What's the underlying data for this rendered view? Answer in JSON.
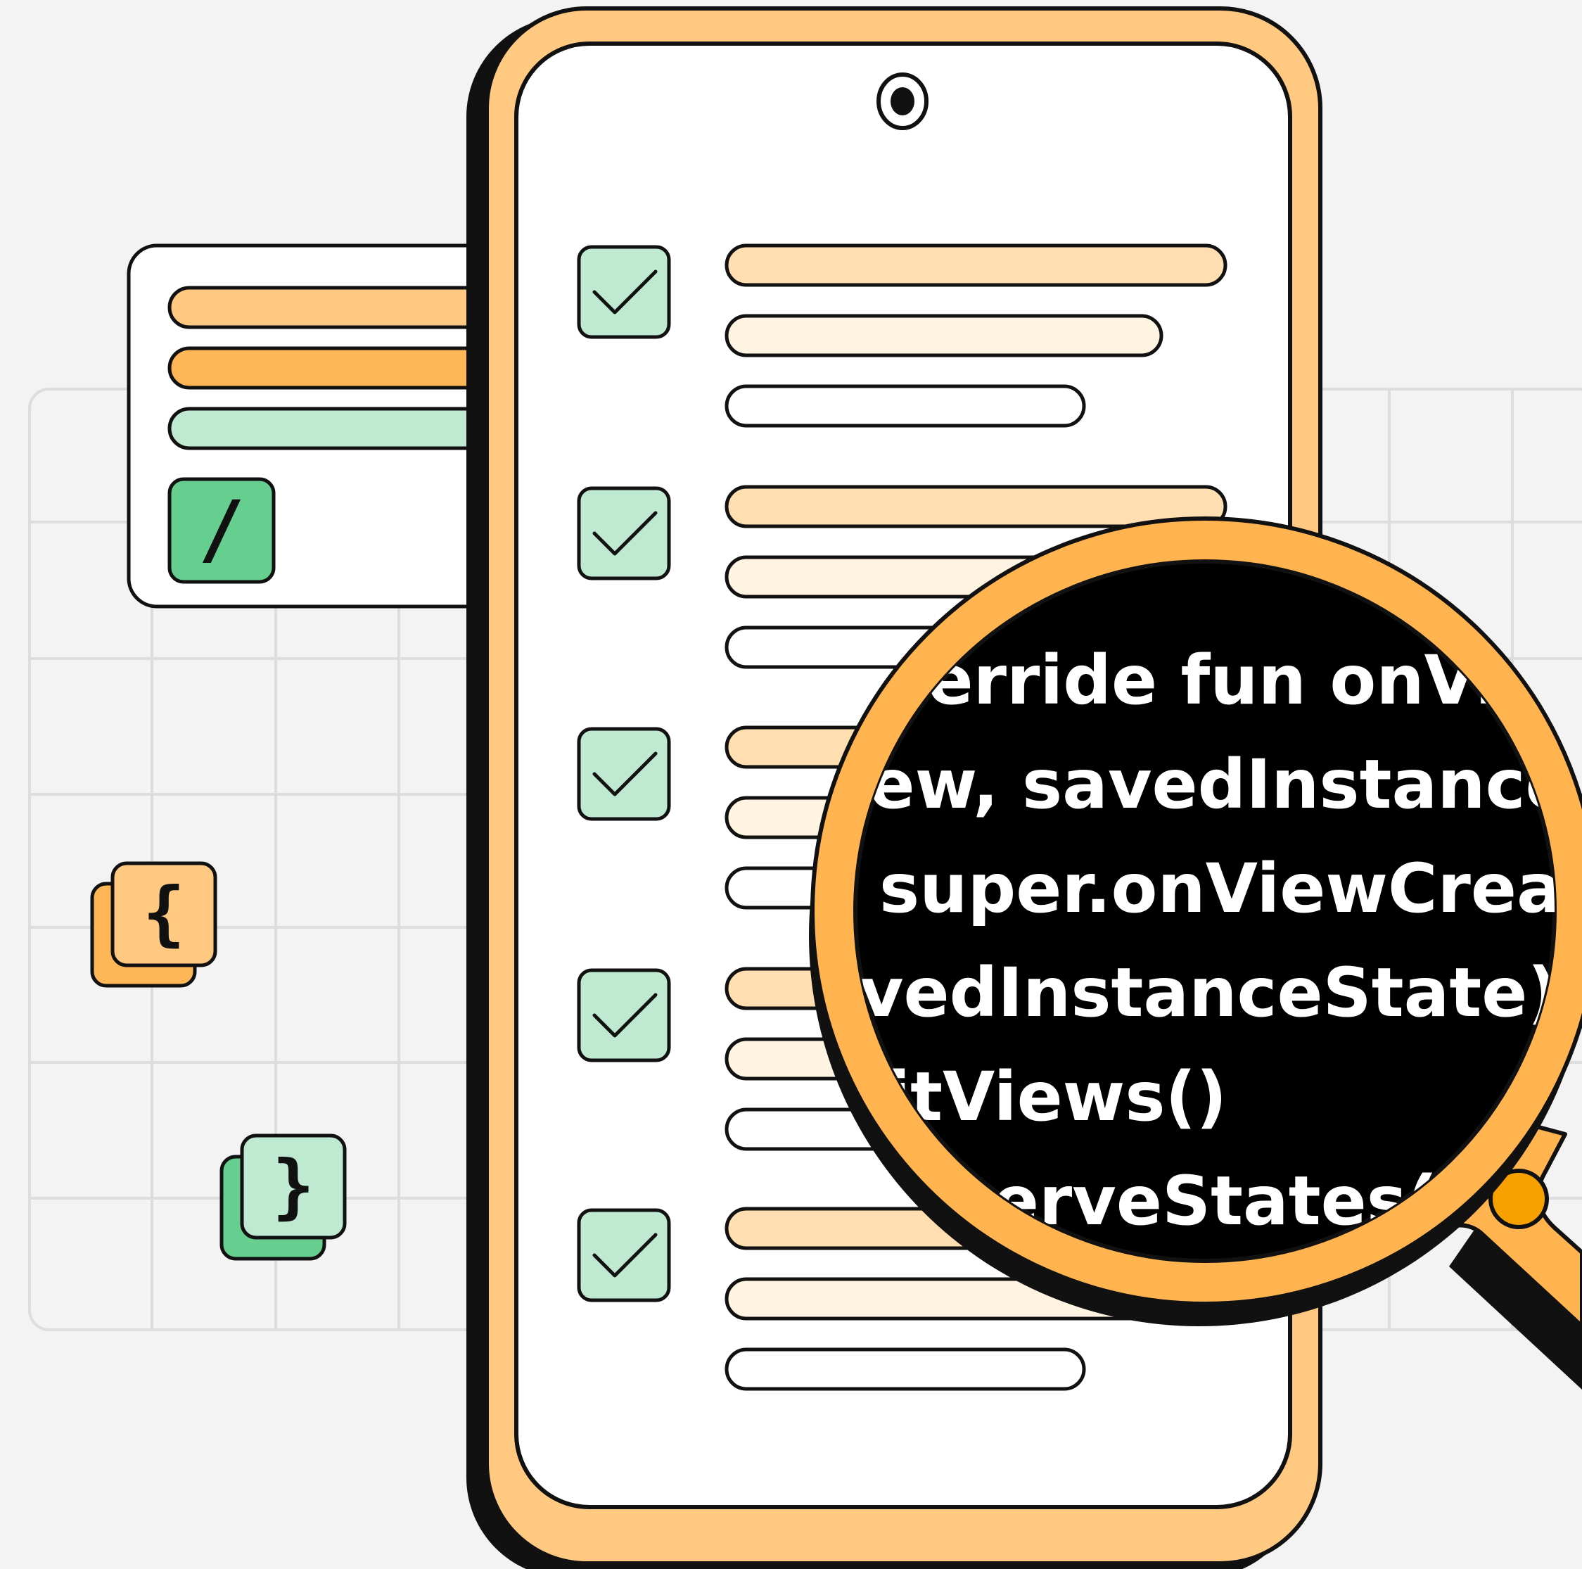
{
  "colors": {
    "background": "#f3f3f3",
    "grid": "#dddddd",
    "outline": "#111111",
    "phone_frame": "#ffc982",
    "magnifier": "#ffb450",
    "magnifier_dot": "#f8a000",
    "bar_peach": "#ffdfb2",
    "bar_cream": "#fff3e2",
    "bar_orange": "#ffb656",
    "bar_mint": "#c0e9d2",
    "checkbox_fill": "#c0e9d2",
    "chip_green": "#66cf8f",
    "lens_bg": "#000000",
    "code": "#ffffff"
  },
  "icons": {
    "checkbox": "checkmark-icon",
    "slash": "slash-icon",
    "open_brace": "open-brace-icon",
    "close_brace": "close-brace-icon",
    "magnifier": "magnifying-glass-icon"
  },
  "glyphs": {
    "slash": "/",
    "open_brace": "{",
    "close_brace": "}"
  },
  "code_lines": [
    "override fun onViewCreated(",
    "view, savedInstanceState",
    "super.onViewCreated(",
    "savedInstanceState)",
    "initViews()",
    "observeStates()"
  ],
  "checklist": {
    "items": [
      {
        "checked": true
      },
      {
        "checked": true
      },
      {
        "checked": true
      },
      {
        "checked": true
      },
      {
        "checked": true
      }
    ]
  }
}
